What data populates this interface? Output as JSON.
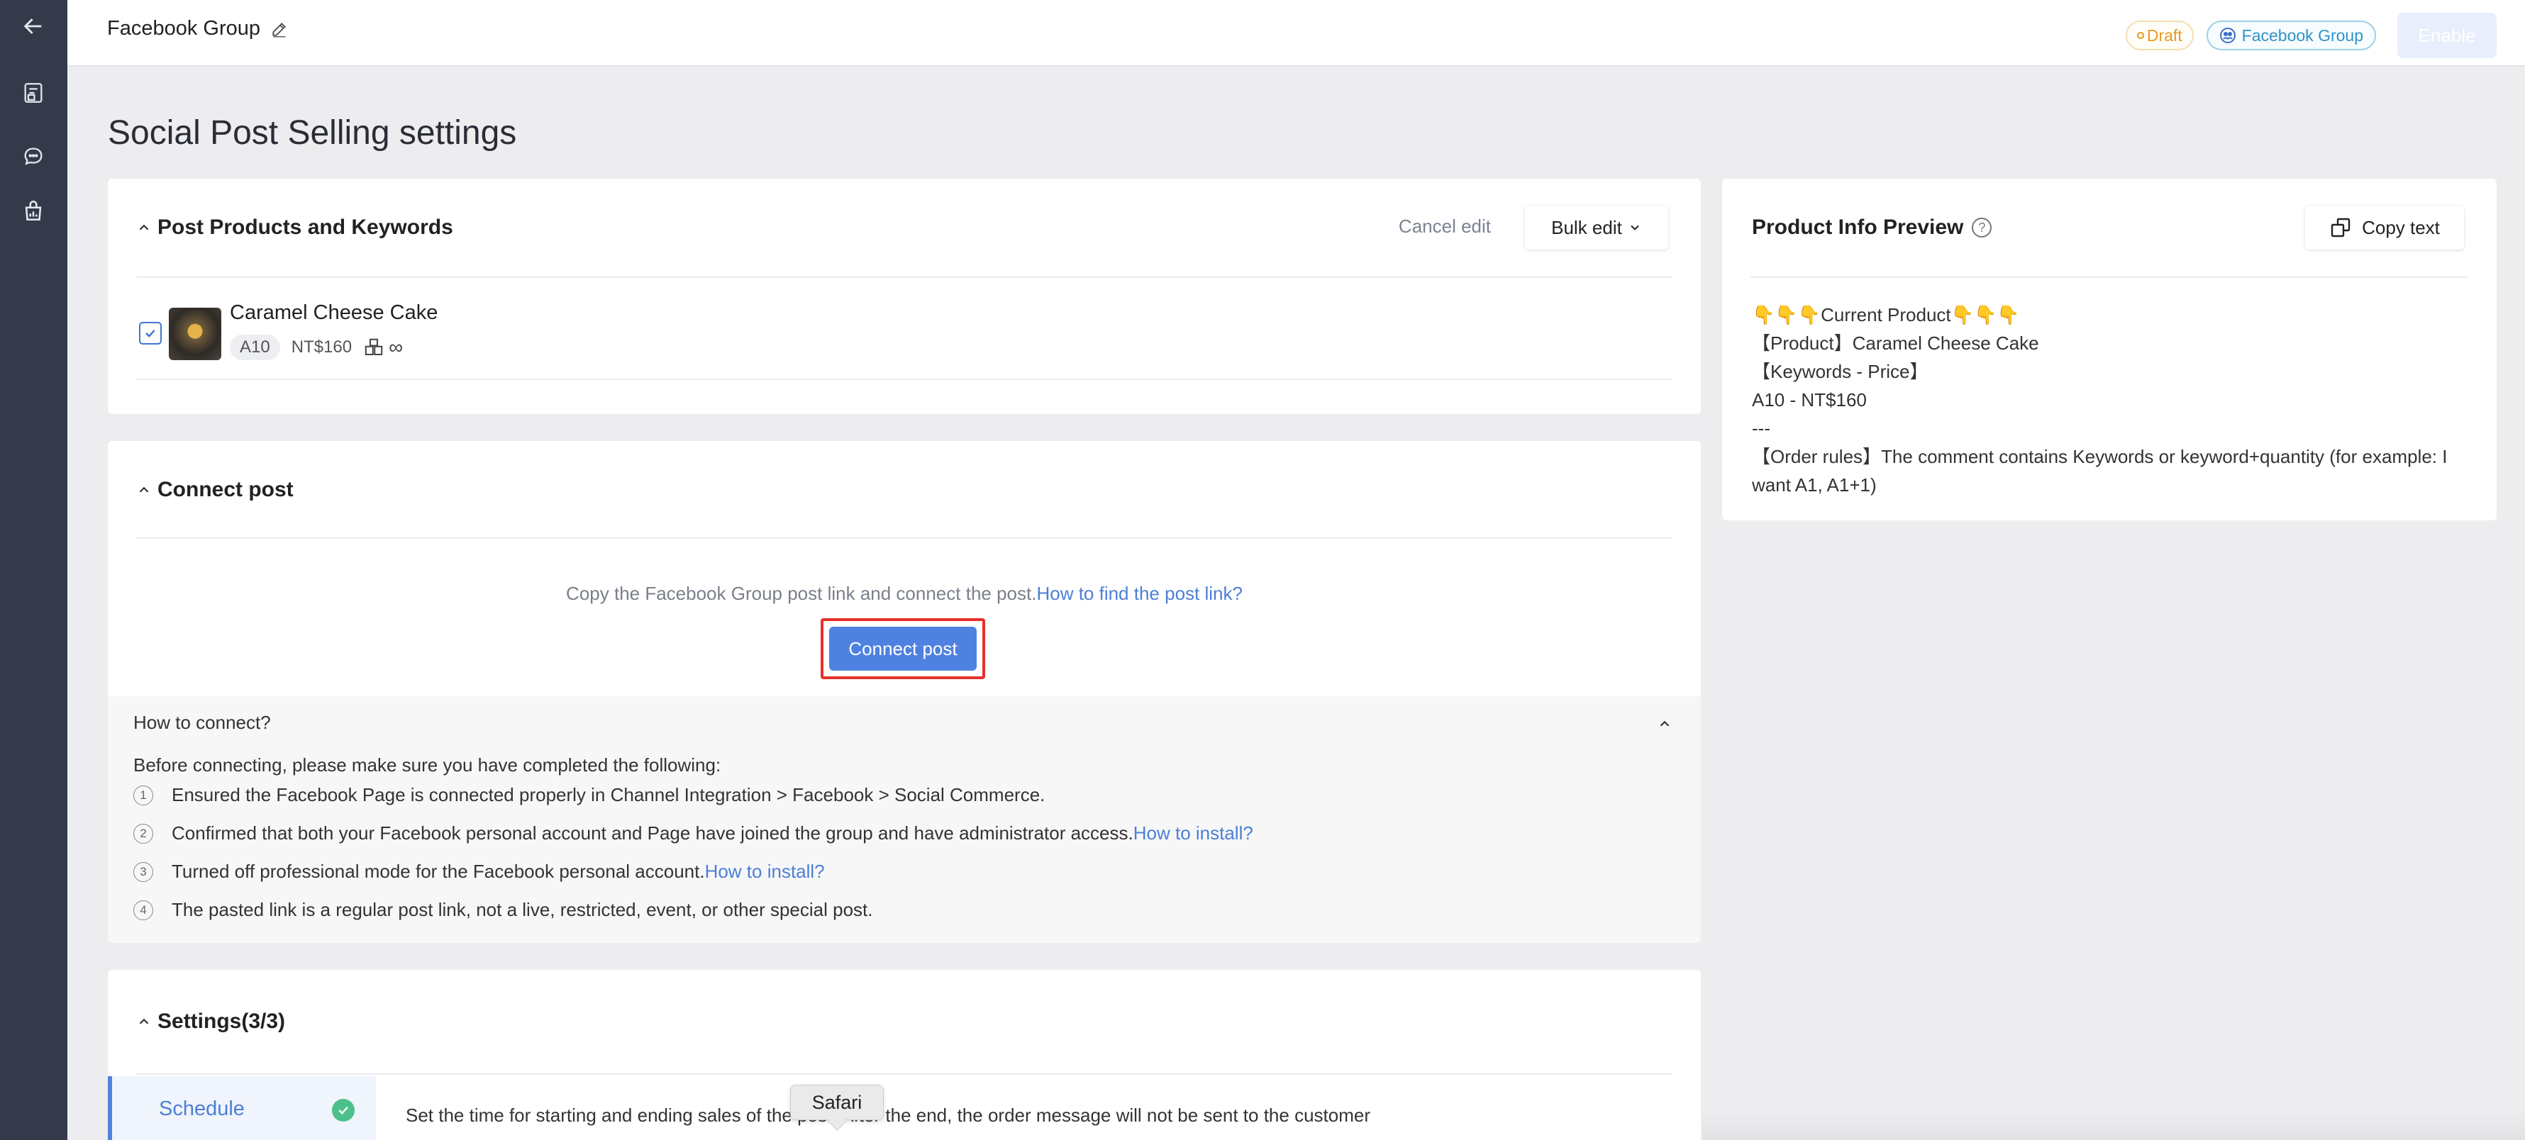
{
  "header": {
    "group_title": "Facebook Group",
    "status_badge": "Draft",
    "channel_badge": "Facebook Group",
    "enable_label": "Enable"
  },
  "page": {
    "title": "Social Post Selling settings"
  },
  "products_card": {
    "title": "Post Products and Keywords",
    "cancel_label": "Cancel edit",
    "bulk_label": "Bulk edit",
    "product": {
      "name": "Caramel Cheese Cake",
      "keyword": "A10",
      "price": "NT$160",
      "stock": "∞",
      "checked": true
    }
  },
  "connect_card": {
    "title": "Connect post",
    "description": "Copy the Facebook Group post link and connect the post.",
    "description_link": "How to find the post link?",
    "button_label": "Connect post",
    "howto": {
      "title": "How to connect?",
      "lead": "Before connecting, please make sure you have completed the following:",
      "steps": [
        {
          "num": "1",
          "text": "Ensured the Facebook Page is connected properly in Channel Integration > Facebook > Social Commerce.",
          "link": ""
        },
        {
          "num": "2",
          "text": "Confirmed that both your Facebook personal account and Page have joined the group and have administrator access.",
          "link": "How to install?"
        },
        {
          "num": "3",
          "text": "Turned off professional mode for the Facebook personal account.",
          "link": "How to install?"
        },
        {
          "num": "4",
          "text": "The pasted link is a regular post link, not a live, restricted, event, or other special post.",
          "link": ""
        }
      ]
    }
  },
  "settings_card": {
    "title": "Settings(3/3)",
    "tab_label": "Schedule",
    "description": "Set the time for starting and ending sales of the post. After the end, the order message will not be sent to the customer"
  },
  "preview_card": {
    "title": "Product Info Preview",
    "copy_label": "Copy text",
    "lines": [
      "👇👇👇Current Product👇👇👇",
      "【Product】Caramel Cheese Cake",
      "【Keywords - Price】",
      "A10 - NT$160",
      "---",
      "【Order rules】The comment contains Keywords or keyword+quantity (for example: I want A1, A1+1)"
    ]
  },
  "tooltip": {
    "text": "Safari"
  },
  "colors": {
    "rail": "#343a4a",
    "primary": "#4f82e0",
    "link": "#4c7fd6",
    "draft": "#e79a20",
    "highlight_border": "#e8302a",
    "success": "#4cc08a"
  }
}
